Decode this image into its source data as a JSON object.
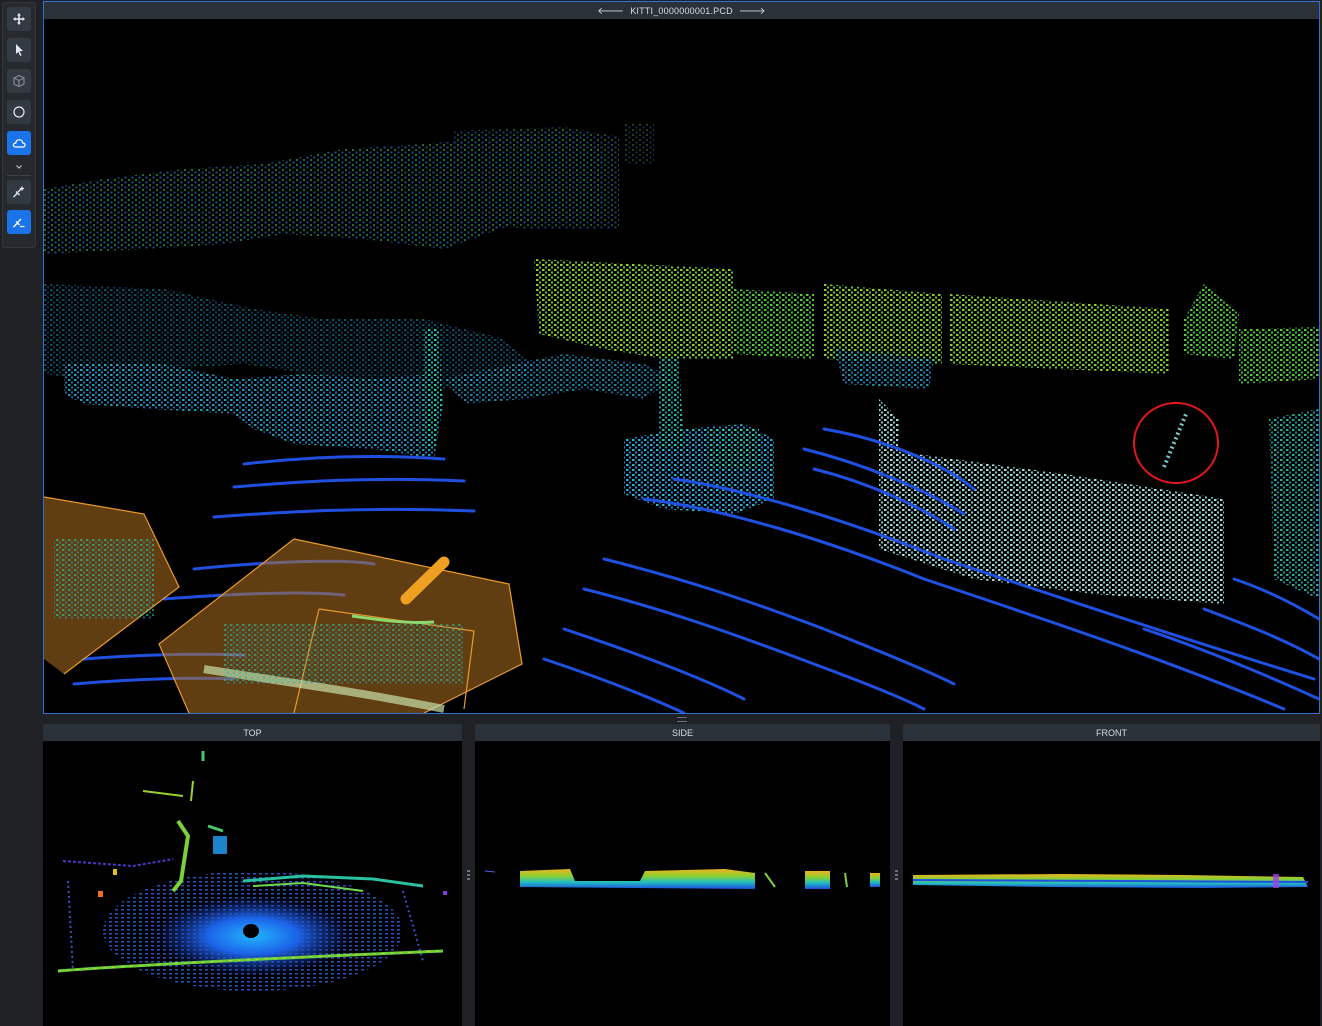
{
  "toolbar": {
    "tools": [
      {
        "name": "move-icon",
        "active": false
      },
      {
        "name": "select-pointer-icon",
        "active": false
      },
      {
        "name": "cube-icon",
        "active": false
      },
      {
        "name": "circle-icon",
        "active": false
      },
      {
        "name": "cloud-icon",
        "active": true
      },
      {
        "name": "chevron-down-icon",
        "active": false
      },
      {
        "name": "brush-add-icon",
        "active": false
      },
      {
        "name": "brush-remove-icon",
        "active": true
      }
    ]
  },
  "viewport": {
    "file_name": "KITTI_0000000001.PCD",
    "prev_arrow": "🡐",
    "next_arrow": "🡒"
  },
  "views": {
    "top": "TOP",
    "side": "SIDE",
    "front": "FRONT"
  },
  "colors": {
    "accent": "#1a73e8",
    "box_fill": "#b07020",
    "box_edge": "#e89a30",
    "annotation_circle": "#e01818"
  }
}
